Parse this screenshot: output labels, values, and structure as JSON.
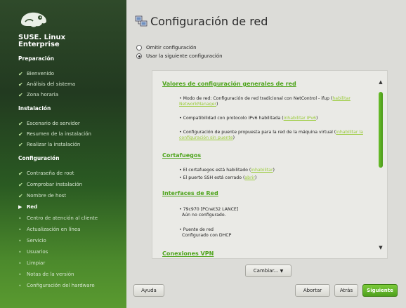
{
  "brand": {
    "line1": "SUSE. Linux",
    "line2": "Enterprise"
  },
  "sidebar": {
    "sections": [
      {
        "title": "Preparación"
      },
      {
        "title": "Instalación"
      },
      {
        "title": "Configuración"
      }
    ],
    "steps": [
      {
        "label": "Bienvenido",
        "state": "done"
      },
      {
        "label": "Análisis del sistema",
        "state": "done"
      },
      {
        "label": "Zona horaria",
        "state": "done"
      },
      {
        "label": "Escenario de servidor",
        "state": "done"
      },
      {
        "label": "Resumen de la instalación",
        "state": "done"
      },
      {
        "label": "Realizar la instalación",
        "state": "done"
      },
      {
        "label": "Contraseña de root",
        "state": "done"
      },
      {
        "label": "Comprobar instalación",
        "state": "done"
      },
      {
        "label": "Nombre de host",
        "state": "done"
      },
      {
        "label": "Red",
        "state": "current"
      },
      {
        "label": "Centro de atención al cliente",
        "state": "pending"
      },
      {
        "label": "Actualización en línea",
        "state": "pending"
      },
      {
        "label": "Servicio",
        "state": "pending"
      },
      {
        "label": "Usuarios",
        "state": "pending"
      },
      {
        "label": "Limpiar",
        "state": "pending"
      },
      {
        "label": "Notas de la versión",
        "state": "pending"
      },
      {
        "label": "Configuración del hardware",
        "state": "pending"
      }
    ]
  },
  "main": {
    "title": "Configuración de red",
    "radio_skip": "Omitir configuración",
    "radio_use": "Usar la siguiente configuración",
    "summary": {
      "general_heading": "Valores de configuración generales de red",
      "mode_text": "Modo de red: Configuración de red tradicional con NetControl - ifup (",
      "mode_link": "habilitar NetworkManager",
      "mode_close": ")",
      "ipv6_text": "Compatibilidad con protocolo IPv6 habilitada (",
      "ipv6_link": "inhabilitar IPv6",
      "ipv6_close": ")",
      "bridge_text": "Configuración de puente propuesta para la red de la máquina virtual (",
      "bridge_link": "inhabilitar la configuración sin puente",
      "bridge_close": ")",
      "firewall_heading": "Cortafuegos",
      "fw_text": "El cortafuegos está habilitado (",
      "fw_link": "inhabilitar",
      "fw_close": ")",
      "ssh_text": "El puerto SSH está cerrado (",
      "ssh_link": "abrir",
      "ssh_close": ")",
      "interfaces_heading": "Interfaces de Red",
      "iface1_name": "79c970 [PCnet32 LANCE]",
      "iface1_status": "Aún no configurado.",
      "iface2_name": "Puente de red",
      "iface2_status": "Configurado con DHCP",
      "next_heading_partial": "Conexiones VPN"
    },
    "change_button": "Cambiar...",
    "change_arrow": "▼"
  },
  "footer": {
    "help": "Ayuda",
    "abort": "Abortar",
    "back": "Atrás",
    "next": "Siguiente"
  },
  "icons": {
    "check": "check-icon",
    "arrow": "arrow-right-icon",
    "bullet": "dot-icon"
  },
  "colors": {
    "accent_green": "#4ea41c",
    "link_green": "#9acb3a",
    "sidebar_bg": "#2f4a2a"
  }
}
